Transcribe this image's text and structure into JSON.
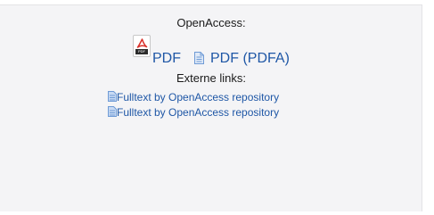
{
  "openaccess": {
    "heading": "OpenAccess:",
    "pdf_icon_tag": "PDF",
    "pdf_label": "PDF",
    "pdfa_label": "PDF (PDFA)"
  },
  "external": {
    "heading": "Externe links:",
    "links": [
      {
        "label": "Fulltext by OpenAccess repository",
        "icon": "document-icon"
      },
      {
        "label": "Fulltext by OpenAccess repository",
        "icon": "document-icon"
      }
    ]
  },
  "colors": {
    "link": "#1f57a6",
    "pdf_red": "#d9302a",
    "doc_blue": "#6f9bd6",
    "panel_bg": "#f4f4f6"
  }
}
